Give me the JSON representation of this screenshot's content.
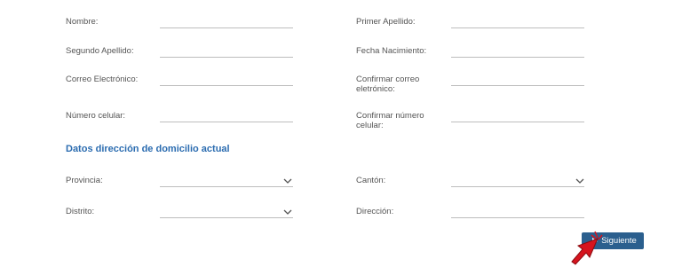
{
  "form": {
    "nombre_label": "Nombre:",
    "primer_apellido_label": "Primer Apellido:",
    "segundo_apellido_label": "Segundo Apellido:",
    "fecha_nacimiento_label": "Fecha Nacimiento:",
    "correo_label": "Correo Electrónico:",
    "confirmar_correo_label_l1": "Confirmar correo",
    "confirmar_correo_label_l2": "eletrónico:",
    "celular_label": "Número celular:",
    "confirmar_celular_label_l1": "Confirmar número",
    "confirmar_celular_label_l2": "celular:"
  },
  "address": {
    "section_title": "Datos dirección de domicilio actual",
    "provincia_label": "Provincia:",
    "canton_label": "Cantón:",
    "distrito_label": "Distrito:",
    "direccion_label": "Dirección:"
  },
  "actions": {
    "next_label": "Siguiente"
  },
  "icons": {
    "dropdown": "chevron-down-icon",
    "next": "play-icon",
    "cursor": "mouse-cursor-icon"
  },
  "colors": {
    "accent": "#2b6cb0",
    "button": "#2b5f8e",
    "cursor": "#d6141e"
  }
}
